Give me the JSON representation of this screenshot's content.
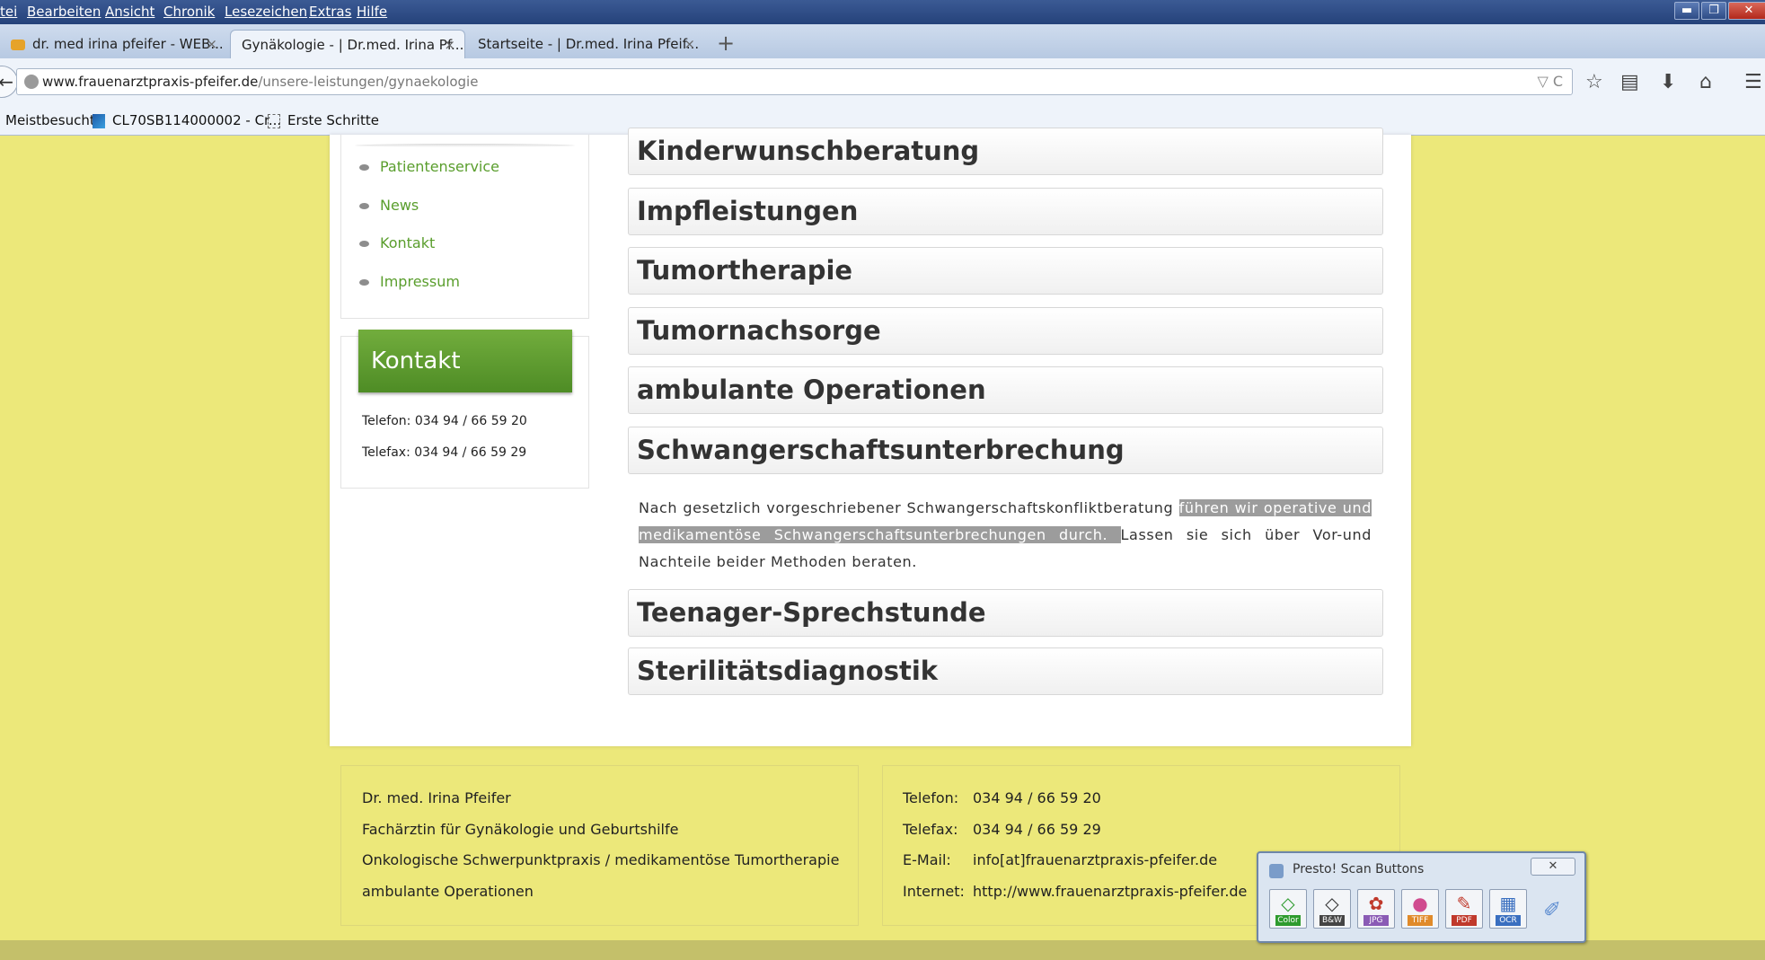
{
  "menubar": {
    "items": [
      "tei",
      "Bearbeiten",
      "Ansicht",
      "Chronik",
      "Lesezeichen",
      "Extras",
      "Hilfe"
    ]
  },
  "tabs": [
    {
      "label": "dr. med irina pfeifer - WEB...",
      "active": false
    },
    {
      "label": "Gynäkologie - | Dr.med. Irina Pf...",
      "active": true
    },
    {
      "label": "Startseite - | Dr.med. Irina Pfeif...",
      "active": false
    }
  ],
  "tab_close": "×",
  "newtab": "+",
  "urlbar": {
    "host": "www.frauenarztpraxis-pfeifer.de",
    "path": "/unsere-leistungen/gynaekologie",
    "controls": "▽ C"
  },
  "bookmarks": [
    "Meistbesucht",
    "CL70SB114000002 - Cr...",
    "Erste Schritte"
  ],
  "sidebar": {
    "links": [
      "Patientenservice",
      "News",
      "Kontakt",
      "Impressum"
    ]
  },
  "kontakt": {
    "title": "Kontakt",
    "telefon": "Telefon: 034 94 / 66 59 20",
    "telefax": "Telefax: 034 94 / 66 59 29"
  },
  "accordion": {
    "items_before": [
      "Kinderwunschberatung",
      "Impfleistungen",
      "Tumortherapie",
      "Tumornachsorge",
      "ambulante Operationen",
      "Schwangerschaftsunterbrechung"
    ],
    "open_text": {
      "part1": "Nach gesetzlich vorgeschriebener Schwangerschaftskonfliktberatung ",
      "highlighted": "führen wir operative und medikamentöse Schwangerschaftsunterbrechungen durch. ",
      "part2": "Lassen sie sich über Vor-und Nachteile beider Methoden beraten."
    },
    "items_after": [
      "Teenager-Sprechstunde",
      "Sterilitätsdiagnostik"
    ]
  },
  "footer": {
    "left": [
      "Dr. med. Irina Pfeifer",
      "Fachärztin für Gynäkologie und Geburtshilfe",
      "Onkologische Schwerpunktpraxis / medikamentöse Tumortherapie",
      "ambulante Operationen"
    ],
    "right_labels": [
      "Telefon:",
      "Telefax:",
      "E-Mail:",
      "Internet:"
    ],
    "right_values": [
      "034 94 / 66 59 20",
      "034 94 / 66 59 29",
      "info[at]frauenarztpraxis-pfeifer.de",
      "http://www.frauenarztpraxis-pfeifer.de"
    ]
  },
  "presto": {
    "title": "Presto! Scan Buttons",
    "buttons": [
      {
        "label": "Color",
        "color": "#2e9b2e"
      },
      {
        "label": "B&W",
        "color": "#444444"
      },
      {
        "label": "JPG",
        "color": "#8a5bb5"
      },
      {
        "label": "TIFF",
        "color": "#e08a2a"
      },
      {
        "label": "PDF",
        "color": "#c0392b"
      },
      {
        "label": "OCR",
        "color": "#3a6fc0"
      },
      {
        "label": "",
        "color": "#5b8bd0"
      }
    ]
  },
  "colors": {
    "page_bg": "#ece87a",
    "accent_green": "#5a9e2d",
    "highlight": "#9c9c9c"
  }
}
